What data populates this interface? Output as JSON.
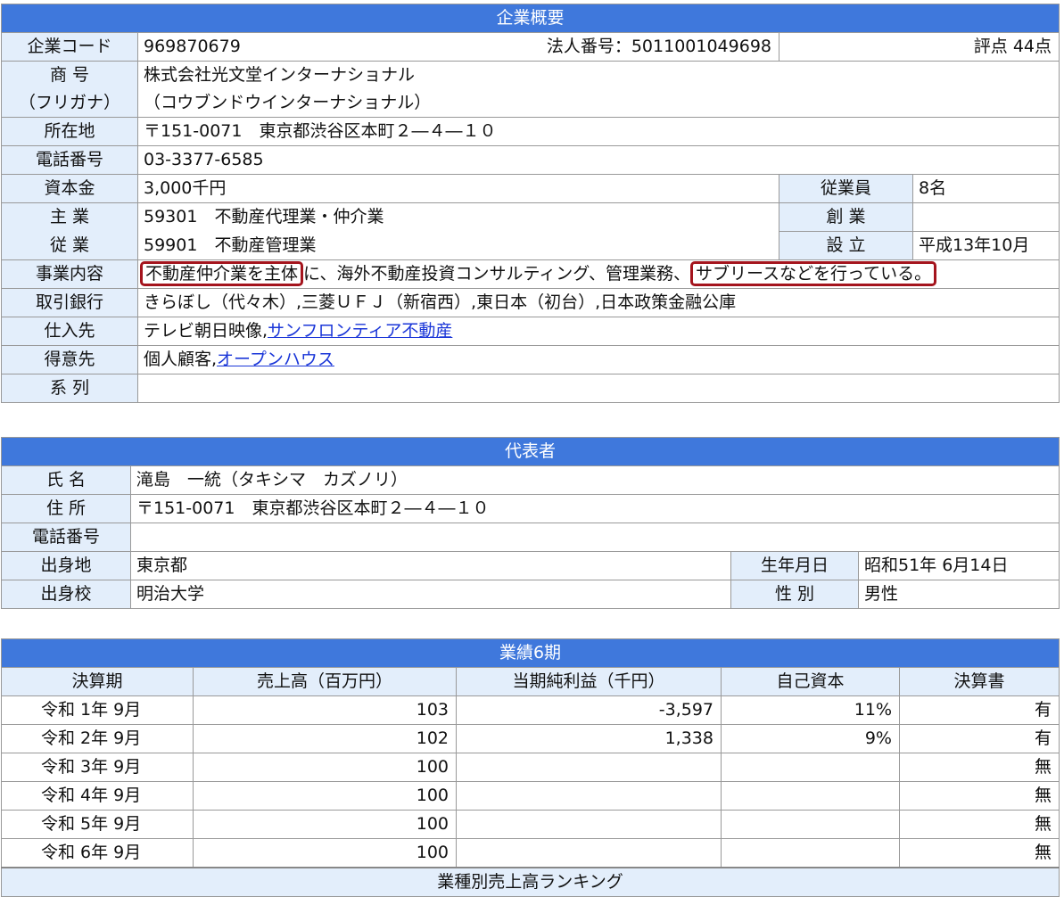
{
  "overview": {
    "header": "企業概要",
    "code_label": "企業コード",
    "code": "969870679",
    "corp_num_label": "法人番号：",
    "corp_num": "5011001049698",
    "score": "評点 44点",
    "name_label": "商 号",
    "name": "株式会社光文堂インターナショナル",
    "kana_label": "（フリガナ）",
    "kana": "（コウブンドウインターナショナル）",
    "address_label": "所在地",
    "address": "〒151-0071　東京都渋谷区本町２―４―１０",
    "phone_label": "電話番号",
    "phone": "03-3377-6585",
    "capital_label": "資本金",
    "capital": "3,000千円",
    "employees_label": "従業員",
    "employees": "8名",
    "main_biz_label": "主 業",
    "main_biz": "59301　不動産代理業・仲介業",
    "founded_label": "創 業",
    "founded": "",
    "sub_biz_label": "従 業",
    "sub_biz": "59901　不動産管理業",
    "established_label": "設 立",
    "established": "平成13年10月",
    "content_label": "事業内容",
    "content_part1": "不動産仲介業を主体",
    "content_part2": "に、海外不動産投資コンサルティング、管理業務、",
    "content_part3": "サブリースなどを行っている。",
    "banks_label": "取引銀行",
    "banks": "きらぼし（代々木）,三菱ＵＦＪ（新宿西）,東日本（初台）,日本政策金融公庫",
    "suppliers_label": "仕入先",
    "supplier_1": "テレビ朝日映像,",
    "supplier_link": "サンフロンティア不動産",
    "customers_label": "得意先",
    "customer_1": "個人顧客,",
    "customer_link": "オープンハウス",
    "affiliate_label": "系 列",
    "affiliate": ""
  },
  "representative": {
    "header": "代表者",
    "name_label": "氏 名",
    "name": "滝島　一統（タキシマ　カズノリ）",
    "address_label": "住 所",
    "address": "〒151-0071　東京都渋谷区本町２―４―１０",
    "phone_label": "電話番号",
    "phone": "",
    "birthplace_label": "出身地",
    "birthplace": "東京都",
    "birthday_label": "生年月日",
    "birthday": "昭和51年 6月14日",
    "school_label": "出身校",
    "school": "明治大学",
    "gender_label": "性 別",
    "gender": "男性"
  },
  "results": {
    "header": "業績6期",
    "columns": [
      "決算期",
      "売上高（百万円）",
      "当期純利益（千円）",
      "自己資本",
      "決算書"
    ],
    "rows": [
      {
        "period": "令和 1年 9月",
        "sales": "103",
        "profit": "-3,597",
        "equity": "11%",
        "statement": "有"
      },
      {
        "period": "令和 2年 9月",
        "sales": "102",
        "profit": "1,338",
        "equity": "9%",
        "statement": "有"
      },
      {
        "period": "令和 3年 9月",
        "sales": "100",
        "profit": "",
        "equity": "",
        "statement": "無"
      },
      {
        "period": "令和 4年 9月",
        "sales": "100",
        "profit": "",
        "equity": "",
        "statement": "無"
      },
      {
        "period": "令和 5年 9月",
        "sales": "100",
        "profit": "",
        "equity": "",
        "statement": "無"
      },
      {
        "period": "令和 6年 9月",
        "sales": "100",
        "profit": "",
        "equity": "",
        "statement": "無"
      }
    ],
    "ranking_header": "業種別売上高ランキング"
  }
}
